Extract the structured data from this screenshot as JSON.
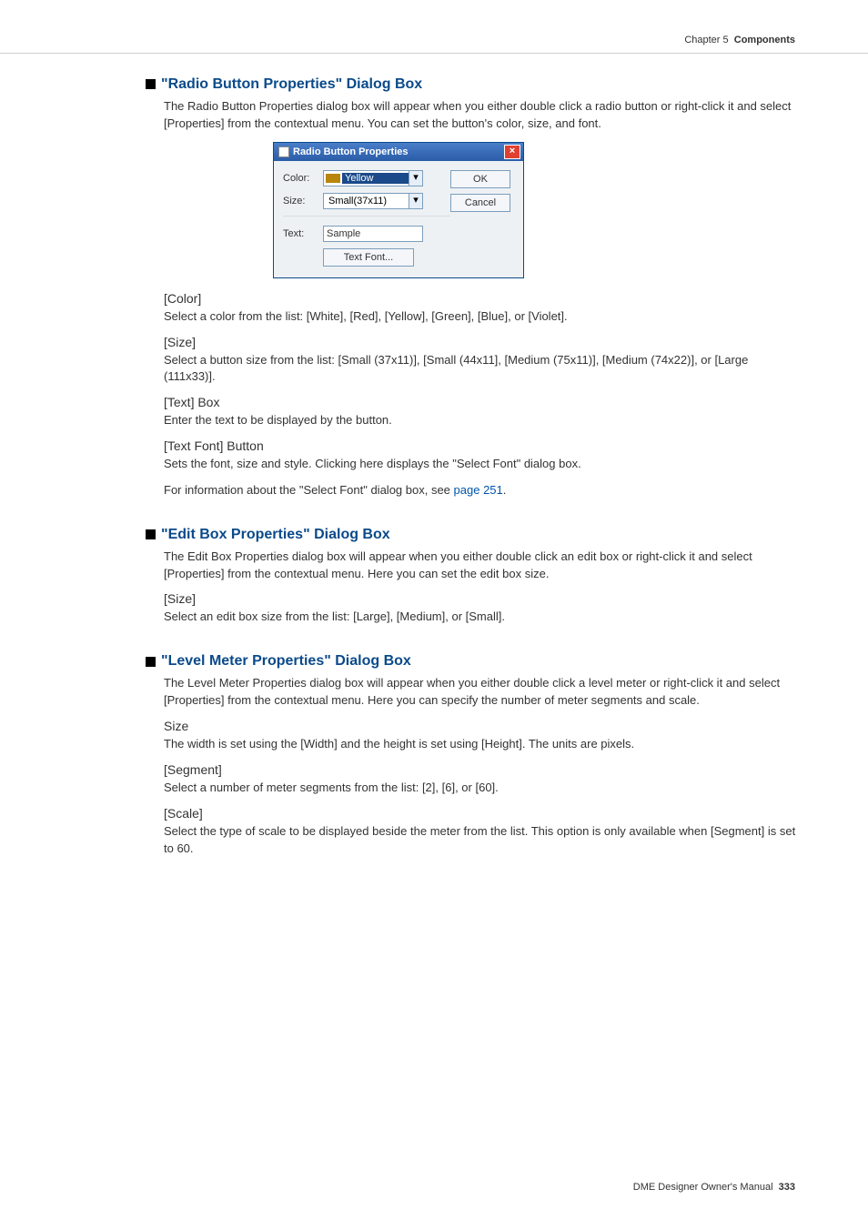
{
  "header": {
    "chapter": "Chapter 5",
    "section": "Components"
  },
  "sections": {
    "radio": {
      "title": "\"Radio Button Properties\" Dialog Box",
      "intro": "The Radio Button Properties dialog box will appear when you either double click a radio button or right-click it and select [Properties] from the contextual menu. You can set the button's color, size, and font.",
      "dialog": {
        "title": "Radio Button Properties",
        "color_label": "Color:",
        "color_value": "Yellow",
        "size_label": "Size:",
        "size_value": "Small(37x11)",
        "text_label": "Text:",
        "text_value": "Sample",
        "textfont_btn": "Text Font...",
        "ok": "OK",
        "cancel": "Cancel"
      },
      "sub": {
        "color_h": "[Color]",
        "color_b": "Select a color from the list: [White], [Red], [Yellow], [Green], [Blue], or [Violet].",
        "size_h": "[Size]",
        "size_b": "Select a button size from the list: [Small (37x11)], [Small (44x11], [Medium (75x11)], [Medium (74x22)], or [Large (111x33)].",
        "text_h": "[Text] Box",
        "text_b": "Enter the text to be displayed by the button.",
        "tf_h": "[Text Font] Button",
        "tf_b1": "Sets the font, size and style. Clicking here displays the \"Select Font\" dialog box.",
        "tf_b2a": "For information about the \"Select Font\" dialog box, see ",
        "tf_link": "page 251",
        "tf_b2b": "."
      }
    },
    "edit": {
      "title": "\"Edit Box Properties\" Dialog Box",
      "intro": "The Edit Box Properties dialog box will appear when you either double click an edit box or right-click it and select [Properties] from the contextual menu. Here you can set the edit box size.",
      "size_h": "[Size]",
      "size_b": "Select an edit box size from the list: [Large], [Medium], or [Small]."
    },
    "level": {
      "title": "\"Level Meter Properties\" Dialog Box",
      "intro": "The Level Meter Properties dialog box will appear when you either double click a level meter or right-click it and select [Properties] from the contextual menu. Here you can specify the number of meter segments and scale.",
      "size_h": "Size",
      "size_b": "The width is set using the [Width] and the height is set using [Height]. The units are pixels.",
      "seg_h": "[Segment]",
      "seg_b": "Select a number of meter segments from the list: [2], [6], or [60].",
      "scale_h": "[Scale]",
      "scale_b": "Select the type of scale to be displayed beside the meter from the list. This option is only available when [Segment] is set to 60."
    }
  },
  "footer": {
    "text": "DME Designer Owner's Manual",
    "page": "333"
  }
}
